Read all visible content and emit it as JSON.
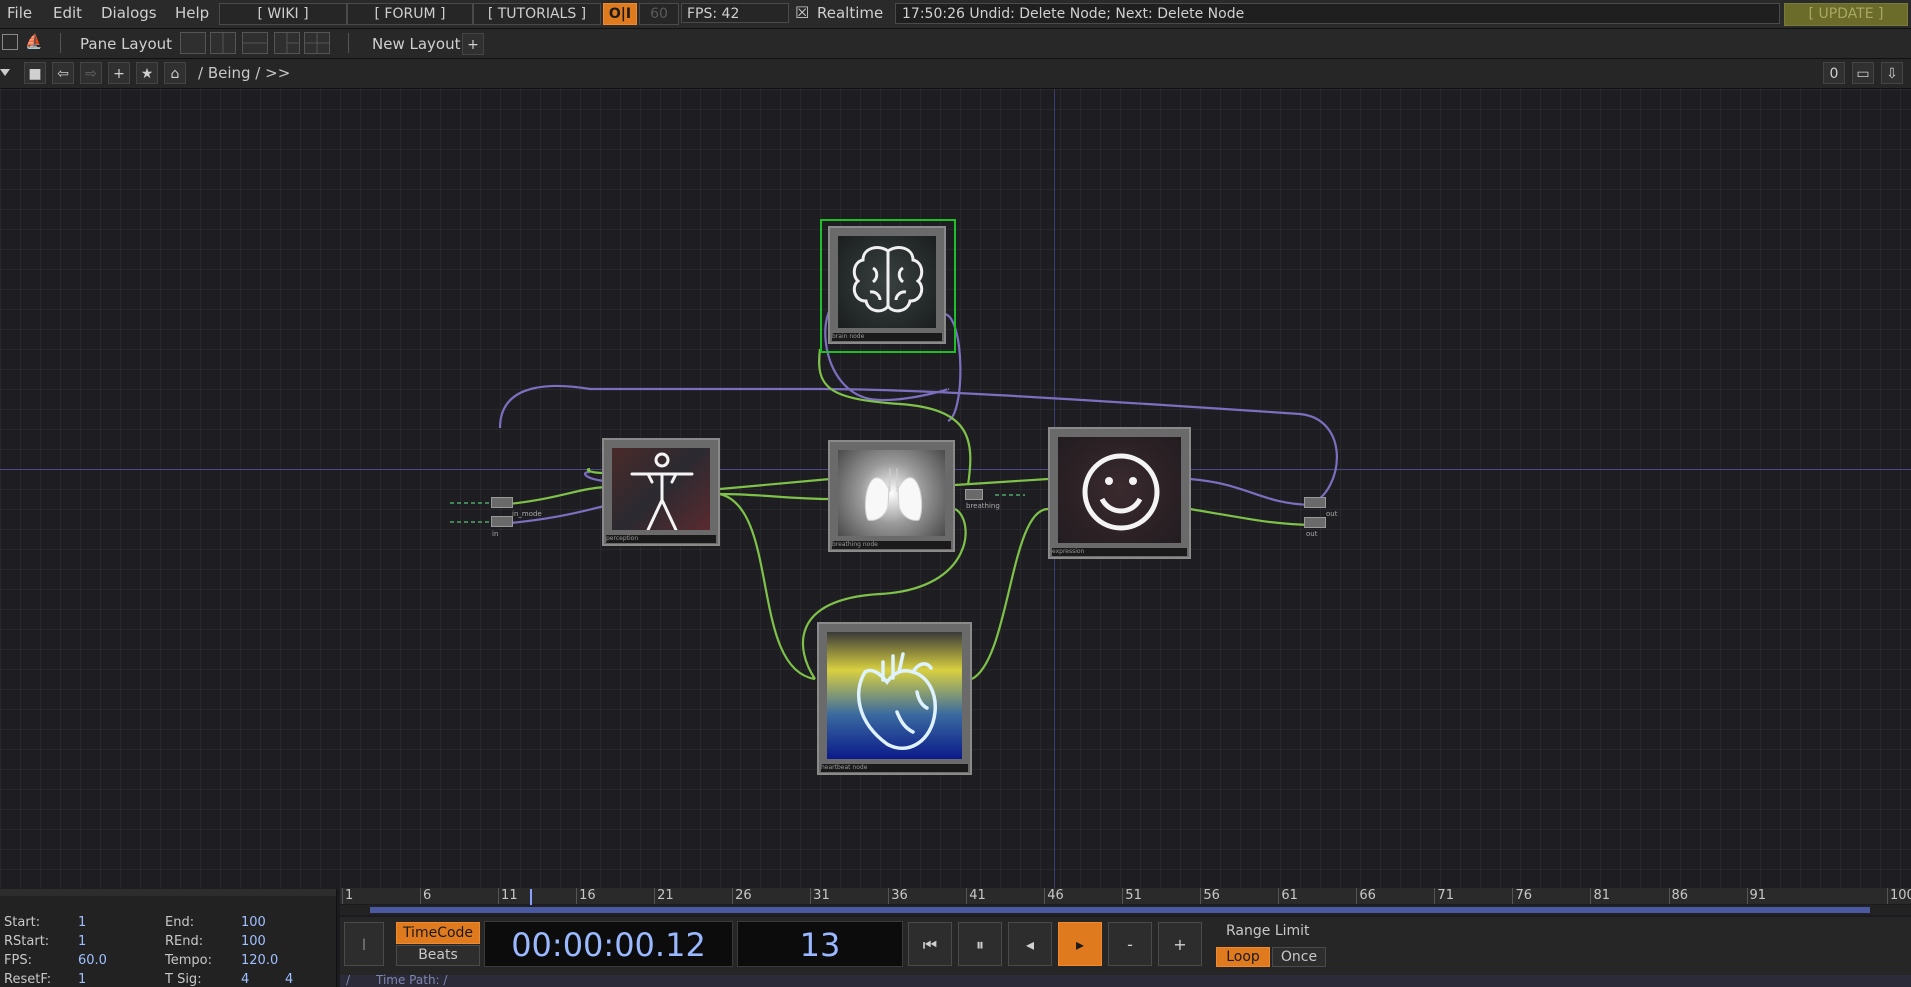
{
  "menu": {
    "file": "File",
    "edit": "Edit",
    "dialogs": "Dialogs",
    "help": "Help"
  },
  "links": {
    "wiki": "[ WIKI ]",
    "forum": "[ FORUM ]",
    "tutorials": "[ TUTORIALS ]"
  },
  "perf": {
    "oi": "O|I",
    "fps_cap": "60",
    "fps_label": "FPS:  42",
    "realtime_check": "☒",
    "realtime": "Realtime"
  },
  "status": "17:50:26 Undid: Delete Node; Next: Delete Node",
  "update": "[ UPDATE ]",
  "panebar": {
    "pane_layout": "Pane Layout",
    "new_layout": "New Layout",
    "plus": "+"
  },
  "pathbar": {
    "path": "/ Being / >>",
    "counter": "0"
  },
  "nodes": {
    "brain": {
      "label": "brain node",
      "icon": "brain-icon"
    },
    "body": {
      "label": "perception",
      "icon": "body-icon"
    },
    "lungs": {
      "label": "breathing node",
      "icon": "lungs-icon"
    },
    "smile": {
      "label": "expression",
      "icon": "smile-icon"
    },
    "heart": {
      "label": "heartbeat node",
      "icon": "heart-icon"
    },
    "small_left_1": "in_mode",
    "small_left_2": "in",
    "small_mid": "breathing",
    "small_right_1": "out",
    "small_right_2": "out"
  },
  "timeline": {
    "ticks": [
      "1",
      "6",
      "11",
      "16",
      "21",
      "26",
      "31",
      "36",
      "41",
      "46",
      "51",
      "56",
      "61",
      "66",
      "71",
      "76",
      "81",
      "86",
      "91",
      "100"
    ],
    "info": {
      "start_k": "Start:",
      "start_v": "1",
      "end_k": "End:",
      "end_v": "100",
      "rstart_k": "RStart:",
      "rstart_v": "1",
      "rend_k": "REnd:",
      "rend_v": "100",
      "fps_k": "FPS:",
      "fps_v": "60.0",
      "tempo_k": "Tempo:",
      "tempo_v": "120.0",
      "resetf_k": "ResetF:",
      "resetf_v": "1",
      "tsig_k": "T Sig:",
      "tsig_v1": "4",
      "tsig_v2": "4"
    },
    "timecode": "TimeCode",
    "beats": "Beats",
    "time": "00:00:00.12",
    "frame": "13",
    "minus": "-",
    "plus": "+",
    "range_limit": "Range Limit",
    "loop": "Loop",
    "once": "Once",
    "timepath": "Time Path: /"
  },
  "colors": {
    "accent": "#e07a1f",
    "wire_green": "#7fc24a",
    "wire_purple": "#7d6fc0",
    "selected": "#1fbf2a"
  }
}
